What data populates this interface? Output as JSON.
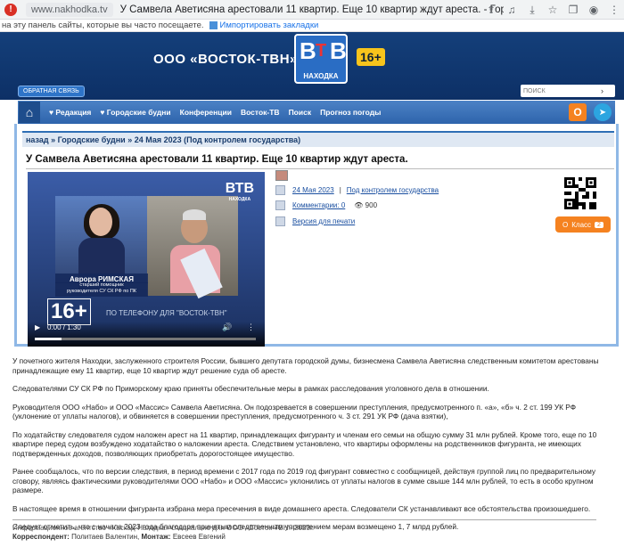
{
  "browser": {
    "url": "www.nakhodka.tv",
    "tab_title": "У Самвела Аветисяна арестовали 11 квартир. Еще 10 квартир ждут ареста. - Городские будн...",
    "bookmarks_hint": "на эту панель сайты, которые вы часто посещаете.",
    "bookmarks_import": "Импортировать закладки"
  },
  "header": {
    "company": "ООО «ВОСТОК-ТВН»",
    "logo_letters": [
      "В",
      "Т",
      "В"
    ],
    "logo_sub": "НАХОДКА",
    "age_badge": "16+",
    "feedback": "ОБРАТНАЯ СВЯЗЬ",
    "search_placeholder": "ПОИСК"
  },
  "nav": {
    "items": [
      "♥ Редакция",
      "♥ Городские будни",
      "Конференции",
      "Восток-ТВ",
      "Поиск",
      "Прогноз погоды"
    ],
    "ok_icon": "ok-icon",
    "telegram_icon": "telegram-icon"
  },
  "breadcrumb": "назад » Городские будни » 24 Мая 2023 (Под контролем государства)",
  "article": {
    "title": "У Самвела Аветисяна арестовали 11 квартир. Еще 10 квартир ждут ареста.",
    "date": "24 Мая 2023",
    "category": "Под контролем государства",
    "comments": "Комментарии: 0",
    "views": "900",
    "print": "Версия для печати",
    "klass_label": "Класс",
    "klass_count": "2"
  },
  "video": {
    "caption_name": "Аврора РИМСКАЯ",
    "caption_sub1": "старший помощник",
    "caption_sub2": "руководителя СУ СК РФ по ПК",
    "logo": "ВТВ",
    "logo_sub": "НАХОДКА",
    "age": "16+",
    "phone_banner": "ПО ТЕЛЕФОНУ ДЛЯ \"ВОСТОК-ТВН\"",
    "time": "0:00 / 1:30",
    "progress": 0.12
  },
  "body": {
    "paragraphs": [
      "У почетного жителя Находки, заслуженного строителя России, бывшего депутата городской думы, бизнесмена Самвела Аветисяна следственным комитетом арестованы принадлежащие ему 11 квартир, еще 10 квартир ждут решение суда об аресте.",
      "Следователями СУ СК РФ по Приморскому краю приняты обеспечительные меры в рамках расследования уголовного дела в отношении.",
      "Руководителя ООО «Набо» и ООО «Массис» Самвела Аветисяна. Он подозревается в совершении преступления, предусмотренного п. «а», «б» ч. 2 ст. 199 УК РФ (уклонение от уплаты налогов), и обвиняется в совершении преступления, предусмотренного ч. 3 ст. 291 УК РФ (дача взятки),",
      "По ходатайству следователя судом наложен арест на 11 квартир, принадлежащих фигуранту и членам его семьи на общую сумму 31 млн рублей. Кроме того, еще по 10 квартире перед судом возбуждено ходатайство о наложении ареста. Следствием установлено, что квартиры оформлены на родственников фигуранта, не имеющих подтвержденных доходов, позволяющих приобретать дорогостоящее имущество.",
      "Ранее сообщалось, что по версии следствия, в период времени с 2017 года по 2019 год фигурант совместно с сообщницей, действуя группой лиц по предварительному сговору, являясь фактическими руководителями ООО «Набо» и ООО «Массис» уклонились от уплаты налогов в сумме свыше 144 млн рублей, то есть в особо крупном размере.",
      "В настоящее время в отношении фигуранта избрана мера пресечения в виде домашнего ареста. Следователи СК устанавливают все обстоятельства произошедшего.",
      "Следует отметить, что с начала 2023 года благодаря принятым следственным управлением мерам возмещено 1, 7 млрд рублей."
    ]
  },
  "footer": {
    "agency": "Информационное агентство «Каскад-Находка» специально для ООО «Восток-ТВН» 2023г.",
    "corr_label": "Корреспондент:",
    "corr_name": "Политаев Валентин,",
    "mont_label": "Монтаж:",
    "mont_name": "Евсеев Евгений"
  }
}
